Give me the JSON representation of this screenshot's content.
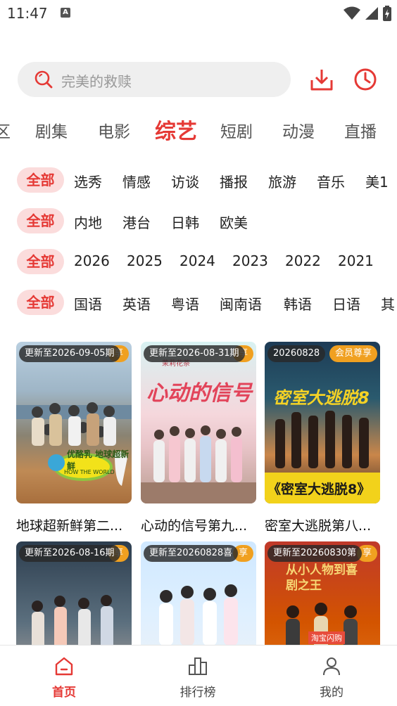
{
  "status_bar": {
    "time": "11:47",
    "notification_icon": "A"
  },
  "search": {
    "placeholder": "完美的救赎"
  },
  "category_tabs": [
    "区",
    "剧集",
    "电影",
    "综艺",
    "短剧",
    "动漫",
    "直播"
  ],
  "active_tab": "综艺",
  "filters": {
    "all_label": "全部",
    "type": [
      "选秀",
      "情感",
      "访谈",
      "播报",
      "旅游",
      "音乐",
      "美1"
    ],
    "region": [
      "内地",
      "港台",
      "日韩",
      "欧美"
    ],
    "year": [
      "2026",
      "2025",
      "2024",
      "2023",
      "2022",
      "2021"
    ],
    "language": [
      "国语",
      "英语",
      "粤语",
      "闽南语",
      "韩语",
      "日语",
      "其"
    ]
  },
  "cards": [
    {
      "title": "地球超新鲜第二...",
      "update": "更新至2026-09-05期",
      "vip": "享"
    },
    {
      "title": "心动的信号第九...",
      "update": "更新至2026-08-31期",
      "vip": "享"
    },
    {
      "title": "密室大逃脱第八...",
      "update": "20260828",
      "vip": "会员尊享"
    },
    {
      "title": "",
      "update": "更新至2026-08-16期",
      "vip": "享"
    },
    {
      "title": "",
      "update": "更新至20260828喜",
      "vip": "享"
    },
    {
      "title": "",
      "update": "更新至20260830第",
      "vip": "享"
    }
  ],
  "posters": [
    {
      "art_text": "优酪乳 地球超新鲜",
      "art_sub": "HOW THE WORLD"
    },
    {
      "art_text": "心动的信号",
      "art_sub": "茉莉花茶"
    },
    {
      "art_text": "密室大逃脱8",
      "art_sub": "《密室大逃脱8》"
    },
    {
      "art_text": "",
      "art_sub": ""
    },
    {
      "art_text": "",
      "art_sub": ""
    },
    {
      "art_text": "从小人物到喜剧之王",
      "art_sub": "淘宝闪购"
    }
  ],
  "bottom_nav": [
    {
      "label": "首页",
      "icon": "home-icon"
    },
    {
      "label": "排行榜",
      "icon": "ranking-icon"
    },
    {
      "label": "我的",
      "icon": "profile-icon"
    }
  ],
  "colors": {
    "accent": "#e53935",
    "chip_bg": "#fbdcdc",
    "vip_badge": "#f0a020"
  }
}
